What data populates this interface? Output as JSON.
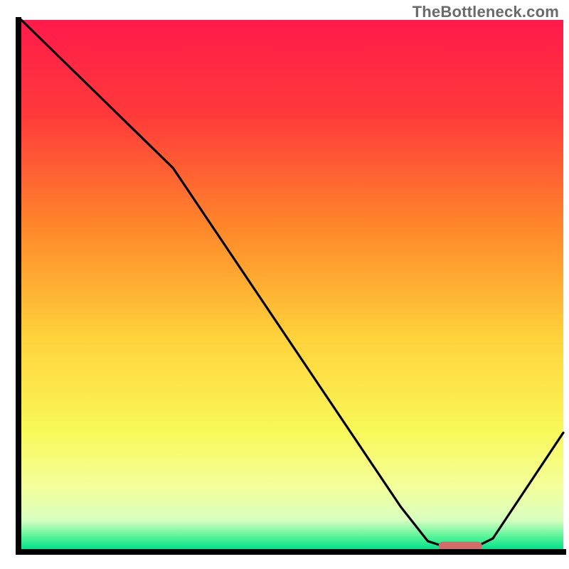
{
  "watermark": "TheBottleneck.com",
  "chart_data": {
    "type": "line",
    "title": "",
    "xlabel": "",
    "ylabel": "",
    "xlim": [
      0,
      100
    ],
    "ylim": [
      0,
      100
    ],
    "grid": false,
    "legend": false,
    "gradient_stops": [
      {
        "offset": 0,
        "color": "#ff1a4b"
      },
      {
        "offset": 0.18,
        "color": "#ff3a3a"
      },
      {
        "offset": 0.4,
        "color": "#ff8a2a"
      },
      {
        "offset": 0.6,
        "color": "#ffd23a"
      },
      {
        "offset": 0.78,
        "color": "#f8f95a"
      },
      {
        "offset": 0.88,
        "color": "#f4ff9a"
      },
      {
        "offset": 0.945,
        "color": "#d8ffc0"
      },
      {
        "offset": 0.975,
        "color": "#5cf59a"
      },
      {
        "offset": 1.0,
        "color": "#00e28a"
      }
    ],
    "series": [
      {
        "name": "bottleneck-curve",
        "color": "#000000",
        "points": [
          {
            "x": 0,
            "y": 100
          },
          {
            "x": 22,
            "y": 78
          },
          {
            "x": 28,
            "y": 72
          },
          {
            "x": 70,
            "y": 8
          },
          {
            "x": 75,
            "y": 1.5
          },
          {
            "x": 78,
            "y": 0.5
          },
          {
            "x": 84,
            "y": 0.5
          },
          {
            "x": 87,
            "y": 2
          },
          {
            "x": 100,
            "y": 22
          }
        ]
      }
    ],
    "marker": {
      "name": "optimal-range",
      "color": "#d46a6a",
      "x_start": 77,
      "x_end": 85,
      "y": 0.6,
      "thickness_pct": 1.6
    },
    "axes": {
      "color": "#000000",
      "thickness_px": 8
    }
  }
}
